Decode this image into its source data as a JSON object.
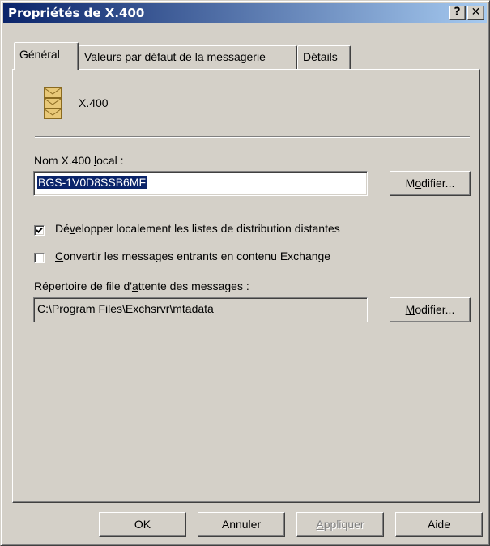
{
  "window": {
    "title": "Propriétés de X.400",
    "help_button": "?",
    "close_button": "✕"
  },
  "tabs": [
    {
      "label": "Général",
      "active": true
    },
    {
      "label": "Valeurs par défaut de la messagerie",
      "active": false
    },
    {
      "label": "Détails",
      "active": false
    }
  ],
  "general": {
    "icon": "envelopes-icon",
    "header_label": "X.400",
    "local_name": {
      "label_pre": "Nom X.400 ",
      "label_accel": "l",
      "label_post": "ocal :",
      "value": "BGS-1V0D8SSB6MF",
      "modify_pre": "M",
      "modify_accel": "o",
      "modify_post": "difier..."
    },
    "expand_dl": {
      "checked": true,
      "label_pre": "Dé",
      "label_accel": "v",
      "label_post": "elopper localement les listes de distribution distantes"
    },
    "convert_messages": {
      "checked": false,
      "label_accel": "C",
      "label_post": "onvertir les messages entrants en contenu Exchange"
    },
    "queue_dir": {
      "label_pre": "Répertoire de file d'",
      "label_accel": "a",
      "label_post": "ttente des messages :",
      "value": "C:\\Program Files\\Exchsrvr\\mtadata",
      "modify_accel": "M",
      "modify_post": "odifier..."
    }
  },
  "footer": {
    "ok": "OK",
    "cancel": "Annuler",
    "apply_accel": "A",
    "apply_post": "ppliquer",
    "help": "Aide"
  },
  "colors": {
    "titlebar_start": "#0a246a",
    "titlebar_end": "#a6caf0",
    "face": "#d4d0c8",
    "selection": "#0a246a"
  }
}
